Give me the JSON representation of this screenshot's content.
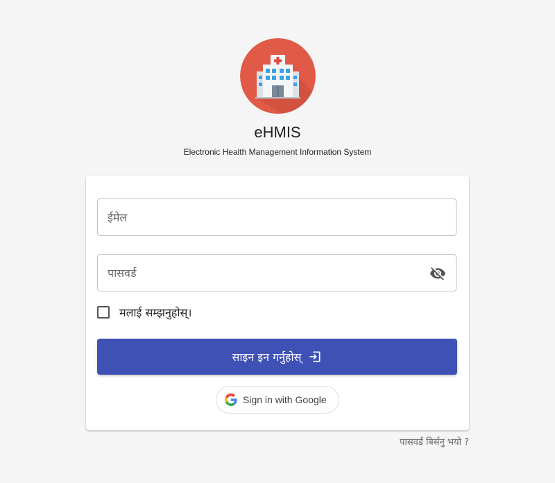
{
  "app": {
    "title": "eHMIS",
    "subtitle": "Electronic Health Management Information System",
    "logo_icon": "hospital-building-icon",
    "logo_bg_color": "#e05a47"
  },
  "login_form": {
    "email_placeholder": "ईमेल",
    "password_placeholder": "पासवर्ड",
    "password_toggle_icon": "eye-off-icon",
    "remember_me_label": "मलाई सम्झनुहोस्।",
    "remember_me_checked": false,
    "submit_label": "साइन इन गर्नुहोस्",
    "submit_icon": "login-arrow-icon",
    "submit_color": "#3f51b5",
    "google_label": "Sign in with Google",
    "google_icon": "google-g-icon"
  },
  "footer": {
    "forgot_password": "पासवर्ड बिर्सनु भयो ?"
  }
}
